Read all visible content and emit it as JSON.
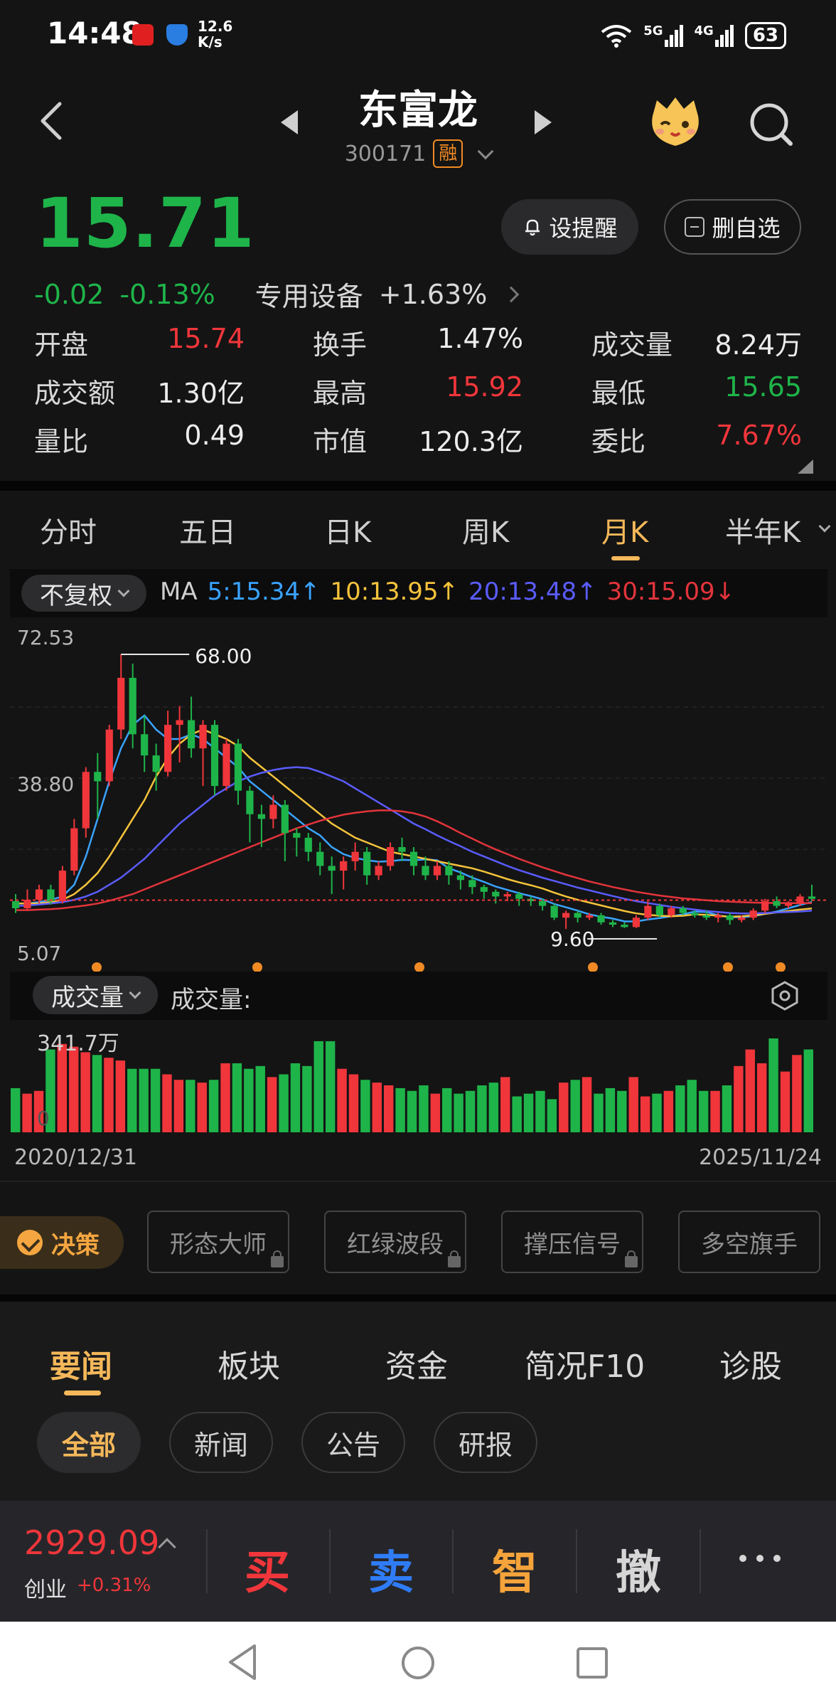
{
  "status_bar": {
    "time": "14:48",
    "net_speed_value": "12.6",
    "net_speed_unit": "K/s",
    "signal_1": "5G",
    "signal_2": "4G",
    "battery": "63"
  },
  "header": {
    "stock_name": "东富龙",
    "stock_code": "300171",
    "margin_badge": "融"
  },
  "quote": {
    "price": "15.71",
    "change": "-0.02",
    "change_pct": "-0.13%",
    "sector_name": "专用设备",
    "sector_change": "+1.63%",
    "set_alert_label": "设提醒",
    "remove_watch_label": "删自选"
  },
  "stats": [
    {
      "label": "开盘",
      "value": "15.74",
      "color": "#f0363b"
    },
    {
      "label": "换手",
      "value": "1.47%",
      "color": "#ececec"
    },
    {
      "label": "成交量",
      "value": "8.24万",
      "color": "#ececec"
    },
    {
      "label": "成交额",
      "value": "1.30亿",
      "color": "#ececec"
    },
    {
      "label": "最高",
      "value": "15.92",
      "color": "#f0363b"
    },
    {
      "label": "最低",
      "value": "15.65",
      "color": "#1eb44a"
    },
    {
      "label": "量比",
      "value": "0.49",
      "color": "#ececec"
    },
    {
      "label": "市值",
      "value": "120.3亿",
      "color": "#ececec"
    },
    {
      "label": "委比",
      "value": "7.67%",
      "color": "#f0363b"
    }
  ],
  "period_tabs": [
    "分时",
    "五日",
    "日K",
    "周K",
    "月K",
    "半年K"
  ],
  "active_period": "月K",
  "ma": {
    "adjust_label": "不复权",
    "title": "MA",
    "items": [
      {
        "text": "5:15.34↑",
        "color": "#3aa3ff"
      },
      {
        "text": "10:13.95↑",
        "color": "#f5c33b"
      },
      {
        "text": "20:13.48↑",
        "color": "#5a5cff"
      },
      {
        "text": "30:15.09↓",
        "color": "#e3343b"
      }
    ]
  },
  "chart_labels": {
    "y_top": "72.53",
    "y_mid": "38.80",
    "y_bottom": "5.07",
    "high_label": "68.00",
    "low_label": "9.60"
  },
  "chart_data": {
    "type": "candlestick",
    "period": "monthly",
    "x_start": "2020/12/31",
    "x_end": "2025/11/24",
    "ylim": [
      5.07,
      72.53
    ],
    "y_ticks": [
      72.53,
      38.8,
      5.07
    ],
    "max_high": 68.0,
    "min_low": 9.6,
    "last_close": 15.71,
    "candles": [
      {
        "o": 15.5,
        "c": 14.0,
        "h": 17.0,
        "l": 13.0
      },
      {
        "o": 14.0,
        "c": 15.8,
        "h": 18.0,
        "l": 13.5
      },
      {
        "o": 15.8,
        "c": 18.0,
        "h": 19.0,
        "l": 15.0
      },
      {
        "o": 18.0,
        "c": 15.5,
        "h": 19.0,
        "l": 14.8
      },
      {
        "o": 15.5,
        "c": 22.0,
        "h": 23.0,
        "l": 15.0
      },
      {
        "o": 22.0,
        "c": 31.0,
        "h": 33.0,
        "l": 21.0
      },
      {
        "o": 31.0,
        "c": 43.0,
        "h": 44.0,
        "l": 29.0
      },
      {
        "o": 43.0,
        "c": 41.0,
        "h": 47.0,
        "l": 33.0
      },
      {
        "o": 41.0,
        "c": 52.0,
        "h": 53.0,
        "l": 40.0
      },
      {
        "o": 52.0,
        "c": 63.0,
        "h": 68.0,
        "l": 50.0
      },
      {
        "o": 63.0,
        "c": 51.0,
        "h": 66.0,
        "l": 48.0
      },
      {
        "o": 51.0,
        "c": 46.5,
        "h": 55.0,
        "l": 43.0
      },
      {
        "o": 46.5,
        "c": 43.0,
        "h": 49.0,
        "l": 39.0
      },
      {
        "o": 43.0,
        "c": 53.0,
        "h": 56.0,
        "l": 42.0
      },
      {
        "o": 53.0,
        "c": 54.0,
        "h": 57.0,
        "l": 45.0
      },
      {
        "o": 54.0,
        "c": 48.0,
        "h": 59.0,
        "l": 46.0
      },
      {
        "o": 48.0,
        "c": 53.0,
        "h": 54.0,
        "l": 40.0
      },
      {
        "o": 53.0,
        "c": 40.0,
        "h": 54.0,
        "l": 38.0
      },
      {
        "o": 40.0,
        "c": 49.0,
        "h": 50.0,
        "l": 39.0
      },
      {
        "o": 49.0,
        "c": 39.0,
        "h": 50.0,
        "l": 36.0
      },
      {
        "o": 39.0,
        "c": 34.0,
        "h": 40.0,
        "l": 28.0
      },
      {
        "o": 34.0,
        "c": 33.0,
        "h": 36.0,
        "l": 27.0
      },
      {
        "o": 33.0,
        "c": 36.0,
        "h": 38.0,
        "l": 31.0
      },
      {
        "o": 36.0,
        "c": 30.0,
        "h": 37.0,
        "l": 24.0
      },
      {
        "o": 30.0,
        "c": 29.0,
        "h": 31.0,
        "l": 25.0
      },
      {
        "o": 29.0,
        "c": 26.0,
        "h": 30.0,
        "l": 24.0
      },
      {
        "o": 26.0,
        "c": 23.0,
        "h": 28.0,
        "l": 21.0
      },
      {
        "o": 23.0,
        "c": 22.0,
        "h": 25.0,
        "l": 17.0
      },
      {
        "o": 22.0,
        "c": 24.0,
        "h": 25.0,
        "l": 18.0
      },
      {
        "o": 24.0,
        "c": 26.0,
        "h": 28.0,
        "l": 22.0
      },
      {
        "o": 26.0,
        "c": 21.0,
        "h": 27.0,
        "l": 19.0
      },
      {
        "o": 21.0,
        "c": 23.0,
        "h": 24.0,
        "l": 20.0
      },
      {
        "o": 23.0,
        "c": 27.0,
        "h": 28.0,
        "l": 22.0
      },
      {
        "o": 27.0,
        "c": 26.0,
        "h": 29.0,
        "l": 24.0
      },
      {
        "o": 26.0,
        "c": 23.0,
        "h": 27.0,
        "l": 21.0
      },
      {
        "o": 23.0,
        "c": 21.0,
        "h": 25.0,
        "l": 20.0
      },
      {
        "o": 21.0,
        "c": 23.0,
        "h": 24.0,
        "l": 20.0
      },
      {
        "o": 23.0,
        "c": 21.0,
        "h": 24.0,
        "l": 19.0
      },
      {
        "o": 21.0,
        "c": 20.0,
        "h": 22.0,
        "l": 18.0
      },
      {
        "o": 20.0,
        "c": 18.5,
        "h": 21.0,
        "l": 17.0
      },
      {
        "o": 18.5,
        "c": 17.5,
        "h": 19.0,
        "l": 16.0
      },
      {
        "o": 17.5,
        "c": 16.5,
        "h": 18.0,
        "l": 15.0
      },
      {
        "o": 16.5,
        "c": 17.0,
        "h": 17.5,
        "l": 15.5
      },
      {
        "o": 17.0,
        "c": 16.0,
        "h": 17.5,
        "l": 14.5
      },
      {
        "o": 16.0,
        "c": 15.5,
        "h": 16.5,
        "l": 14.5
      },
      {
        "o": 15.5,
        "c": 14.5,
        "h": 16.0,
        "l": 13.5
      },
      {
        "o": 14.5,
        "c": 12.0,
        "h": 15.0,
        "l": 11.5
      },
      {
        "o": 12.0,
        "c": 13.0,
        "h": 13.5,
        "l": 9.6
      },
      {
        "o": 13.0,
        "c": 12.0,
        "h": 13.5,
        "l": 11.0
      },
      {
        "o": 12.0,
        "c": 12.5,
        "h": 13.0,
        "l": 11.5
      },
      {
        "o": 12.5,
        "c": 11.0,
        "h": 13.0,
        "l": 10.5
      },
      {
        "o": 11.0,
        "c": 10.5,
        "h": 11.5,
        "l": 10.0
      },
      {
        "o": 10.5,
        "c": 10.0,
        "h": 11.0,
        "l": 9.8
      },
      {
        "o": 10.0,
        "c": 12.0,
        "h": 12.5,
        "l": 9.8
      },
      {
        "o": 12.0,
        "c": 14.5,
        "h": 15.5,
        "l": 11.5
      },
      {
        "o": 14.5,
        "c": 12.5,
        "h": 15.0,
        "l": 12.0
      },
      {
        "o": 12.5,
        "c": 14.0,
        "h": 14.5,
        "l": 12.0
      },
      {
        "o": 14.0,
        "c": 13.0,
        "h": 14.5,
        "l": 12.5
      },
      {
        "o": 13.0,
        "c": 12.5,
        "h": 13.5,
        "l": 12.0
      },
      {
        "o": 12.5,
        "c": 12.0,
        "h": 13.5,
        "l": 11.5
      },
      {
        "o": 12.0,
        "c": 12.5,
        "h": 13.0,
        "l": 11.0
      },
      {
        "o": 12.5,
        "c": 11.5,
        "h": 13.0,
        "l": 10.5
      },
      {
        "o": 11.5,
        "c": 12.0,
        "h": 12.5,
        "l": 11.0
      },
      {
        "o": 12.0,
        "c": 13.5,
        "h": 14.0,
        "l": 11.5
      },
      {
        "o": 13.5,
        "c": 15.5,
        "h": 16.0,
        "l": 13.0
      },
      {
        "o": 15.5,
        "c": 14.5,
        "h": 16.5,
        "l": 14.0
      },
      {
        "o": 14.5,
        "c": 15.0,
        "h": 15.5,
        "l": 14.0
      },
      {
        "o": 15.0,
        "c": 16.5,
        "h": 17.0,
        "l": 14.5
      },
      {
        "o": 16.5,
        "c": 16.0,
        "h": 19.0,
        "l": 15.5
      }
    ],
    "ma_series": [
      {
        "name": "MA5",
        "color": "#3aa3ff",
        "last": 15.34,
        "values": [
          15,
          15,
          15.3,
          15.8,
          16.5,
          19,
          25,
          33,
          41,
          48,
          53,
          55,
          52,
          50,
          50,
          51,
          50,
          48,
          46,
          44,
          41,
          39,
          37,
          35,
          33,
          31,
          29.5,
          27,
          25.5,
          24.7,
          24.2,
          23.9,
          24,
          24.3,
          24.2,
          24.4,
          24.2,
          22.5,
          21.6,
          20.5,
          19.6,
          18.6,
          17.9,
          17.2,
          16.6,
          15.9,
          14.9,
          14.2,
          13.5,
          12.7,
          12.2,
          11.8,
          11.2,
          11.2,
          11.6,
          11.9,
          12.3,
          12.7,
          13.3,
          13.2,
          12.5,
          12.1,
          12.1,
          12.3,
          12.8,
          13.3,
          14.0,
          14.7,
          15.34
        ]
      },
      {
        "name": "MA10",
        "color": "#f5c33b",
        "last": 13.95,
        "values": [
          15,
          15,
          15,
          15.3,
          15.8,
          17,
          19,
          21.5,
          25,
          29,
          33,
          37,
          42,
          46,
          49,
          51,
          52,
          51,
          50,
          48.5,
          46,
          44,
          42,
          40,
          38,
          36,
          34,
          32,
          30.5,
          29,
          28,
          27,
          26,
          25.5,
          25,
          24.5,
          24,
          23.5,
          23,
          22.5,
          21.8,
          21,
          20.2,
          19.5,
          18.9,
          18.2,
          17.3,
          16.5,
          15.8,
          15.2,
          14.6,
          14,
          13.4,
          12.9,
          12.6,
          12.4,
          12.3,
          12.4,
          12.7,
          12.6,
          12.4,
          12.2,
          12.3,
          12.5,
          12.8,
          13.1,
          13.4,
          13.7,
          13.95
        ]
      },
      {
        "name": "MA20",
        "color": "#5a5cff",
        "last": 13.48,
        "values": [
          14.5,
          14.6,
          14.8,
          15,
          15.3,
          15.8,
          16.5,
          17.5,
          19,
          20.5,
          22.5,
          24.5,
          27,
          29.5,
          32,
          34,
          36,
          38,
          39.5,
          41,
          42,
          42.8,
          43.4,
          43.8,
          44,
          43.8,
          43,
          42,
          41,
          39.5,
          38,
          36.5,
          35,
          33.5,
          32,
          30.8,
          29.5,
          28.3,
          27.2,
          26,
          25,
          24,
          23,
          22.1,
          21.3,
          20.5,
          19.8,
          19.1,
          18.4,
          17.8,
          17.2,
          16.6,
          16,
          15.5,
          15.1,
          14.7,
          14.3,
          14,
          13.7,
          13.4,
          13.2,
          13,
          12.9,
          12.9,
          13,
          13.1,
          13.2,
          13.3,
          13.48
        ]
      },
      {
        "name": "MA30",
        "color": "#e3343b",
        "last": 15.09,
        "values": [
          13.6,
          13.6,
          13.7,
          13.8,
          14,
          14.3,
          14.6,
          15,
          15.6,
          16.3,
          17,
          18,
          19,
          20,
          21,
          22,
          23,
          24,
          25,
          26,
          27,
          28,
          29,
          30,
          31,
          31.8,
          32.6,
          33.3,
          33.9,
          34.3,
          34.6,
          34.8,
          34.8,
          34.6,
          34.2,
          33.5,
          32.5,
          31.3,
          30,
          28.8,
          27.6,
          26.5,
          25.5,
          24.5,
          23.6,
          22.7,
          21.9,
          21.1,
          20.4,
          19.7,
          19.1,
          18.5,
          18,
          17.5,
          17.1,
          16.7,
          16.4,
          16.1,
          15.9,
          15.7,
          15.5,
          15.4,
          15.3,
          15.2,
          15.15,
          15.12,
          15.1,
          15.09,
          15.09
        ]
      }
    ],
    "volume": {
      "label": "成交量",
      "max_label": "341.7万",
      "zero_label": "0",
      "values": [
        160,
        140,
        150,
        300,
        320,
        310,
        290,
        280,
        270,
        260,
        230,
        230,
        230,
        210,
        190,
        190,
        180,
        190,
        250,
        250,
        230,
        240,
        200,
        210,
        250,
        240,
        330,
        330,
        230,
        210,
        190,
        180,
        170,
        160,
        150,
        170,
        140,
        160,
        140,
        150,
        170,
        180,
        200,
        130,
        140,
        150,
        120,
        180,
        190,
        200,
        140,
        160,
        150,
        200,
        130,
        140,
        150,
        170,
        190,
        150,
        150,
        170,
        240,
        300,
        250,
        340,
        220,
        280,
        300
      ]
    },
    "volume_colors": "red when close>=open, green otherwise"
  },
  "volume_section": {
    "select_label": "成交量",
    "title": "成交量:",
    "date_start": "2020/12/31",
    "date_end": "2025/11/24"
  },
  "decision": {
    "label": "决策",
    "tools": [
      "形态大师",
      "红绿波段",
      "撑压信号",
      "多空旗手"
    ]
  },
  "news": {
    "tabs": [
      "要闻",
      "板块",
      "资金",
      "简况F10",
      "诊股"
    ],
    "active_tab": "要闻",
    "filters": [
      "全部",
      "新闻",
      "公告",
      "研报"
    ],
    "active_filter": "全部"
  },
  "trade_bar": {
    "index_value": "2929.09",
    "index_name": "创业",
    "index_change": "+0.31%",
    "buttons": [
      {
        "label": "买",
        "color": "#f0363b"
      },
      {
        "label": "卖",
        "color": "#2f7cf6"
      },
      {
        "label": "智",
        "color": "#f5a33b"
      },
      {
        "label": "撤",
        "color": "#d6d6d6"
      }
    ]
  },
  "colors": {
    "up": "#f0363b",
    "down": "#1eb44a",
    "accent": "#f5b85a",
    "background": "#141414"
  }
}
